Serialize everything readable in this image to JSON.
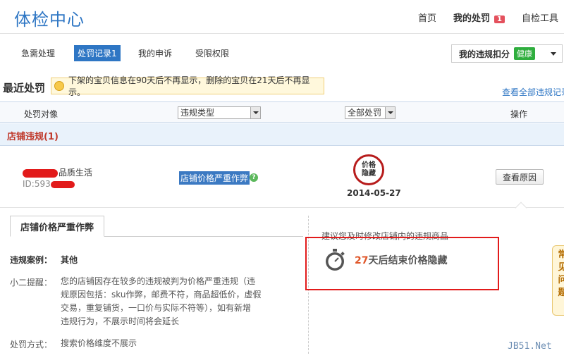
{
  "brand": "体检中心",
  "topnav": {
    "home": "首页",
    "my_penalty": "我的处罚",
    "my_penalty_badge": "1",
    "self_check": "自检工具"
  },
  "subnav": {
    "tabs": [
      "急需处理",
      "处罚记录1",
      "我的申诉",
      "受限权限"
    ],
    "active_index": 1
  },
  "deduction_dropdown": {
    "label": "我的违规扣分",
    "status": "健康"
  },
  "recent": {
    "title": "最近处罚",
    "notice": "下架的宝贝信息在90天后不再显示，删除的宝贝在21天后不再显示。",
    "view_all": "查看全部违规记录"
  },
  "table_header": {
    "target": "处罚对像",
    "violation_type": "违规类型",
    "all_penalty": "全部处罚",
    "action": "操作"
  },
  "section": {
    "title": "店铺违规(1)"
  },
  "row": {
    "shop_name": "品质生活",
    "shop_id": "ID:593",
    "violation": "店铺价格严重作弊",
    "stamp_line1": "价格",
    "stamp_line2": "隐藏",
    "date": "2014-05-27",
    "reason_button": "查看原因"
  },
  "detail": {
    "tab": "店铺价格严重作弊",
    "case_label": "违规案例：",
    "case_value": "其他",
    "tip_label": "小二提醒：",
    "tip_lines": [
      "您的店铺因存在较多的违规被判为价格严重违规（违",
      "规原因包括：sku作弊，邮费不符，商品超低价，虚假",
      "交易，重复铺货，一口价与实际不符等），如有新增",
      "违规行为，不展示时间将会延长"
    ],
    "method_label": "处罚方式：",
    "method_value": "搜索价格维度不展示",
    "suggest": "建议您及时修改店铺内的违规商品",
    "countdown_days": "27",
    "countdown_text": "天后结束价格隐藏"
  },
  "side_tip": [
    "常",
    "见",
    "问",
    "题"
  ],
  "watermark": "JB51.Net"
}
